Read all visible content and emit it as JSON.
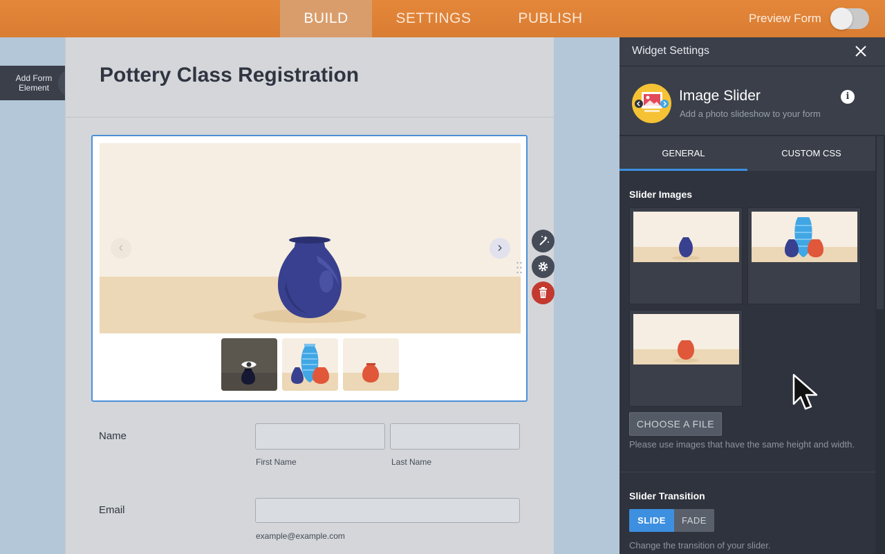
{
  "topbar": {
    "tabs": [
      {
        "label": "BUILD",
        "active": true
      },
      {
        "label": "SETTINGS",
        "active": false
      },
      {
        "label": "PUBLISH",
        "active": false
      }
    ],
    "preview_label": "Preview Form",
    "preview_enabled": false
  },
  "canvas": {
    "add_element_label": "Add Form Element",
    "form_title": "Pottery Class Registration"
  },
  "fields": {
    "name": {
      "label": "Name",
      "first_sub": "First Name",
      "last_sub": "Last Name",
      "first_value": "",
      "last_value": ""
    },
    "email": {
      "label": "Email",
      "sub": "example@example.com",
      "value": ""
    }
  },
  "panel": {
    "header": "Widget Settings",
    "widget_name": "Image Slider",
    "widget_desc": "Add a photo slideshow to your form",
    "tabs": [
      {
        "label": "GENERAL",
        "active": true
      },
      {
        "label": "CUSTOM CSS",
        "active": false
      }
    ],
    "slider_images_title": "Slider Images",
    "choose_file_label": "CHOOSE A FILE",
    "choose_file_hint": "Please use images that have the same height and width.",
    "transition_title": "Slider Transition",
    "transition_options": [
      "SLIDE",
      "FADE"
    ],
    "transition_selected": "SLIDE",
    "transition_hint": "Change the transition of your slider."
  },
  "colors": {
    "topbar": "#e4873a",
    "accent_blue": "#3d8fe0",
    "delete_red": "#c4392f",
    "panel_bg": "#2f333d",
    "vase_navy": "#38408f",
    "vase_blue": "#41a6e4",
    "vase_orange": "#e0573a"
  },
  "icons": {
    "add": "plus-icon",
    "close": "close-icon",
    "info": "info-icon",
    "prev": "chevron-left-icon",
    "next": "chevron-right-icon",
    "magic": "magic-wand-icon",
    "settings": "gear-icon",
    "delete": "trash-icon",
    "preview": "eye-icon"
  }
}
